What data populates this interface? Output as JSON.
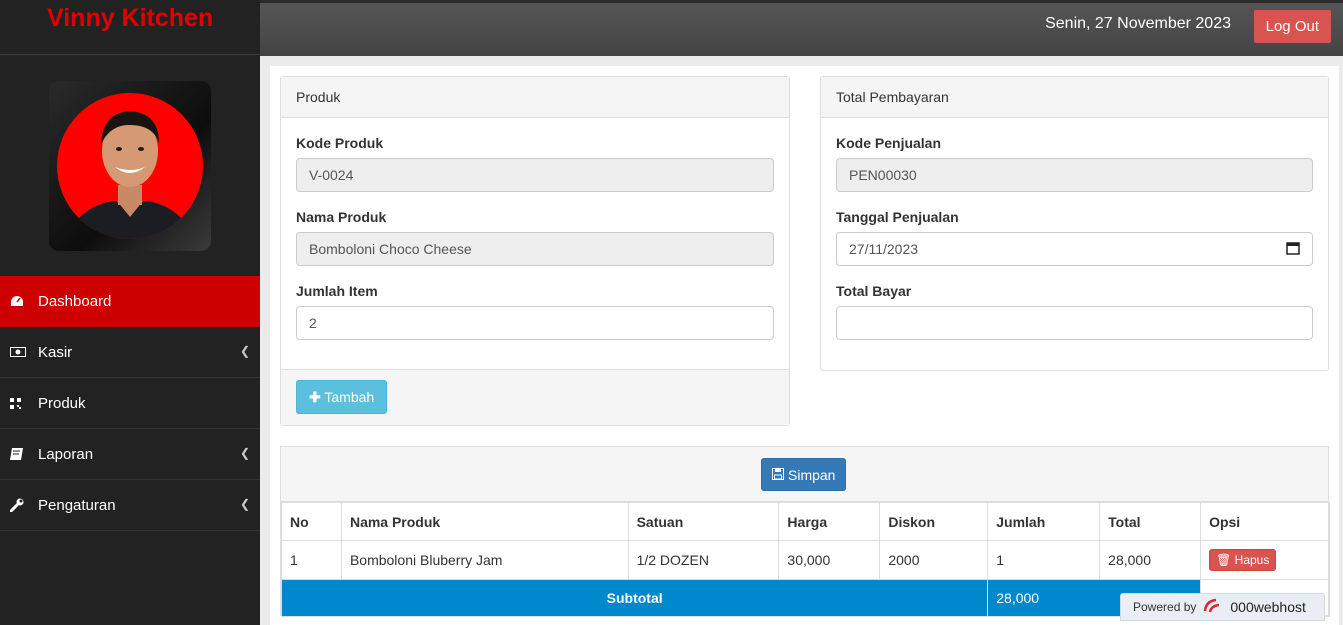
{
  "brand": "Vinny Kitchen",
  "topbar": {
    "date": "Senin, 27 November 2023",
    "logout": "Log Out"
  },
  "nav": [
    {
      "label": "Dashboard",
      "icon": "dashboard-icon",
      "active": true,
      "chevron": false
    },
    {
      "label": "Kasir",
      "icon": "money-icon",
      "active": false,
      "chevron": true
    },
    {
      "label": "Produk",
      "icon": "qrcode-icon",
      "active": false,
      "chevron": false
    },
    {
      "label": "Laporan",
      "icon": "book-icon",
      "active": false,
      "chevron": true
    },
    {
      "label": "Pengaturan",
      "icon": "wrench-icon",
      "active": false,
      "chevron": true
    }
  ],
  "produk_panel": {
    "heading": "Produk",
    "kode_label": "Kode Produk",
    "kode_value": "V-0024",
    "nama_label": "Nama Produk",
    "nama_value": "Bomboloni Choco Cheese",
    "jumlah_label": "Jumlah Item",
    "jumlah_value": "2",
    "tambah": "Tambah"
  },
  "bayar_panel": {
    "heading": "Total Pembayaran",
    "kode_label": "Kode Penjualan",
    "kode_value": "PEN00030",
    "tanggal_label": "Tanggal Penjualan",
    "tanggal_value": "27/11/2023",
    "total_label": "Total Bayar",
    "total_value": ""
  },
  "simpan": "Simpan",
  "table": {
    "headers": [
      "No",
      "Nama Produk",
      "Satuan",
      "Harga",
      "Diskon",
      "Jumlah",
      "Total",
      "Opsi"
    ],
    "rows": [
      {
        "no": "1",
        "nama": "Bomboloni Bluberry Jam",
        "satuan": "1/2 DOZEN",
        "harga": "30,000",
        "diskon": "2000",
        "jumlah": "1",
        "total": "28,000",
        "opsi": "Hapus"
      }
    ],
    "subtotal_label": "Subtotal",
    "subtotal_value": "28,000"
  },
  "powered": {
    "prefix": "Powered by",
    "name": "000webhost"
  },
  "colors": {
    "brand_red": "#e00000",
    "active_nav": "#cc0000",
    "subtotal_blue": "#0088cc",
    "info": "#5bc0de",
    "primary": "#337ab7",
    "danger": "#d9534f"
  }
}
